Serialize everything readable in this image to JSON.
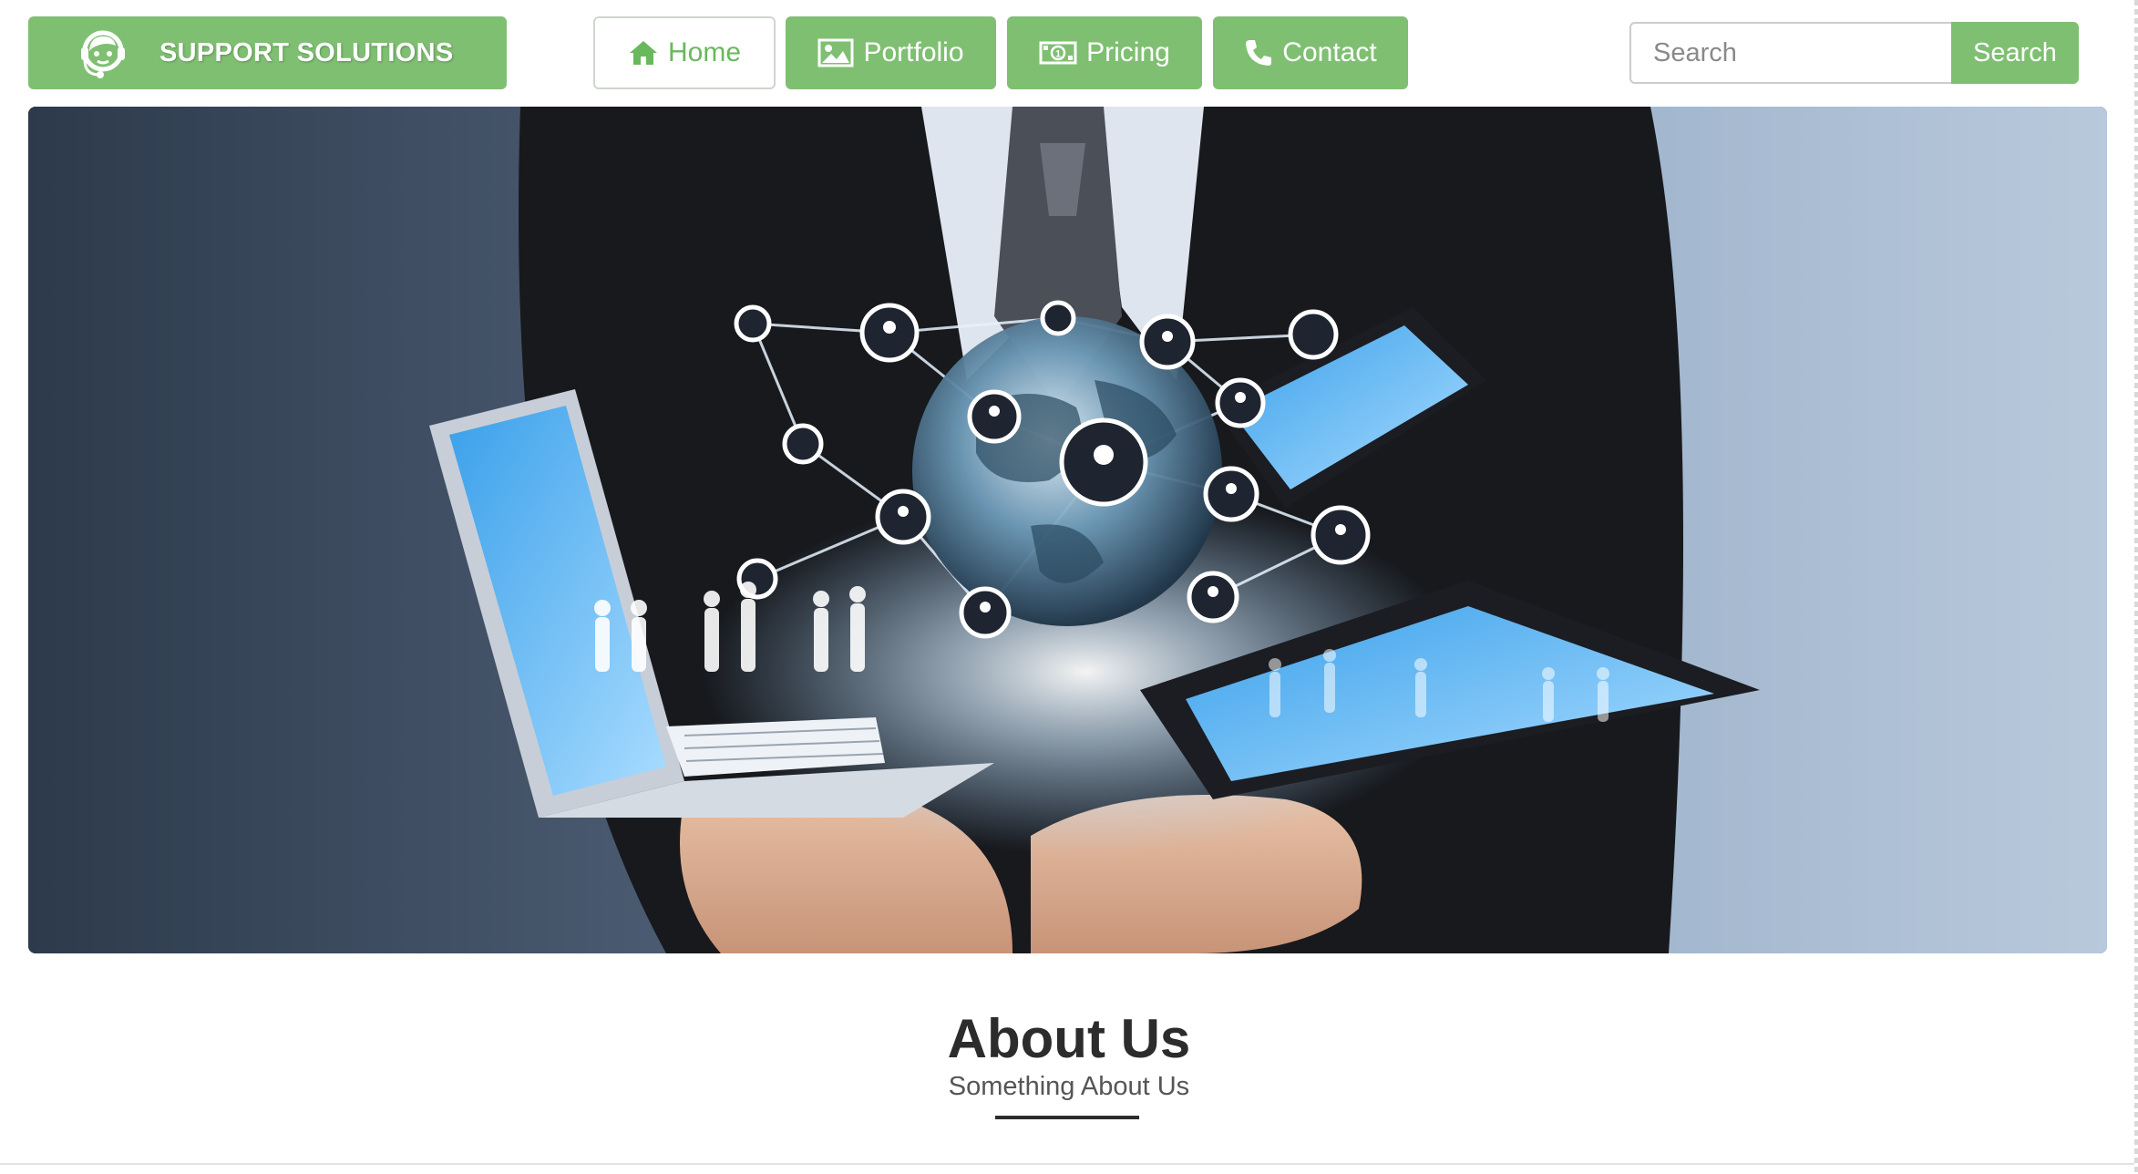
{
  "brand": {
    "name": "SUPPORT SOLUTIONS",
    "icon": "support-agent-headset-icon"
  },
  "nav": {
    "items": [
      {
        "label": "Home",
        "icon": "home-icon",
        "active": true
      },
      {
        "label": "Portfolio",
        "icon": "image-icon",
        "active": false
      },
      {
        "label": "Pricing",
        "icon": "money-icon",
        "active": false
      },
      {
        "label": "Contact",
        "icon": "phone-icon",
        "active": false
      }
    ]
  },
  "search": {
    "placeholder": "Search",
    "value": "",
    "button_label": "Search"
  },
  "hero": {
    "image": "business-person-holding-laptop-tablet-phone-globe-network"
  },
  "about": {
    "title": "About Us",
    "subtitle": "Something About Us"
  },
  "colors": {
    "accent": "#7fbf72",
    "accent_text": "#6ab85e",
    "heading": "#2c2c2c",
    "subtext": "#555555"
  }
}
